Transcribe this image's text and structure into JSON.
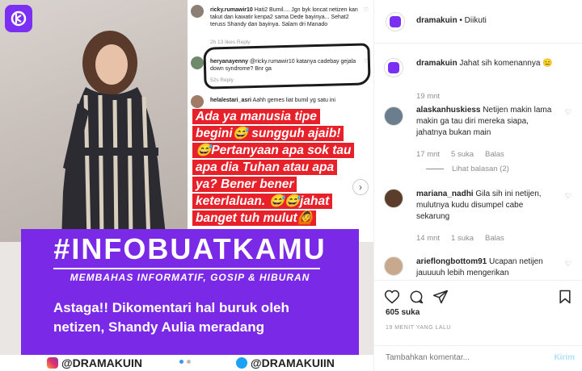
{
  "post_image": {
    "comments": [
      {
        "user": "ricky.rumawir10",
        "text": "Hati2 Bumil.... Jgn byk loncat netizen kan takut dan kawatir kenpa2 sama Dede bayinya... Sehat2 teruss Shandy dan bayinya. Salam dri Manado",
        "meta": "2h   13 likes   Reply"
      },
      {
        "user": "heryanayenny",
        "text": "@ricky.rumawir10 katanya cadebay gejala down syndrome? Bnr ga",
        "meta": "52s   Reply"
      },
      {
        "user": "helalestari_asri",
        "text": "Aahh gemes liat bumil yg satu ini",
        "meta": ""
      }
    ],
    "red_caption": [
      "Ada ya manusia tipe",
      "begini😅 sungguh ajaib!",
      "😅Pertanyaan apa sok tau",
      "apa dia Tuhan atau apa",
      "ya? Bener bener",
      "keterlaluan. 😅😅jahat",
      "banget tuh mulut🙆"
    ],
    "banner_title": "#INFOBUATKAMU",
    "banner_subtitle": "MEMBAHAS INFORMATIF, GOSIP & HIBURAN",
    "banner_headline": "Astaga!! Dikomentari hal buruk oleh netizen, Shandy Aulia meradang",
    "footer_left": "@DRAMAKUIN",
    "footer_right": "@DRAMAKUIIN"
  },
  "header": {
    "username": "dramakuin",
    "separator": "•",
    "follow_status": "Diikuti"
  },
  "comments": [
    {
      "user": "dramakuin",
      "text": "Jahat sih komenannya 😑",
      "time": "19 mnt",
      "likes": "",
      "reply": ""
    },
    {
      "user": "alaskanhuskiess",
      "text": "Netijen makin lama makin ga tau diri mereka siapa, jahatnya bukan main",
      "time": "17 mnt",
      "likes": "5 suka",
      "reply": "Balas",
      "view_replies": "Lihat balasan (2)"
    },
    {
      "user": "mariana_nadhi",
      "text": "Gila sih ini netijen, mulutnya kudu disumpel cabe sekarung",
      "time": "14 mnt",
      "likes": "1 suka",
      "reply": "Balas"
    },
    {
      "user": "arieflongbottom91",
      "text": "Ucapan netijen jauuuuh lebih mengerikan",
      "time": "",
      "likes": "",
      "reply": ""
    }
  ],
  "actions": {
    "likes": "605 suka",
    "timestamp": "19 MENIT YANG LALU",
    "comment_placeholder": "Tambahkan komentar...",
    "post_label": "Kirim"
  },
  "colors": {
    "brand_purple": "#7a2ae6",
    "caption_red": "#e8202a",
    "link_blue": "#b2dffc"
  }
}
